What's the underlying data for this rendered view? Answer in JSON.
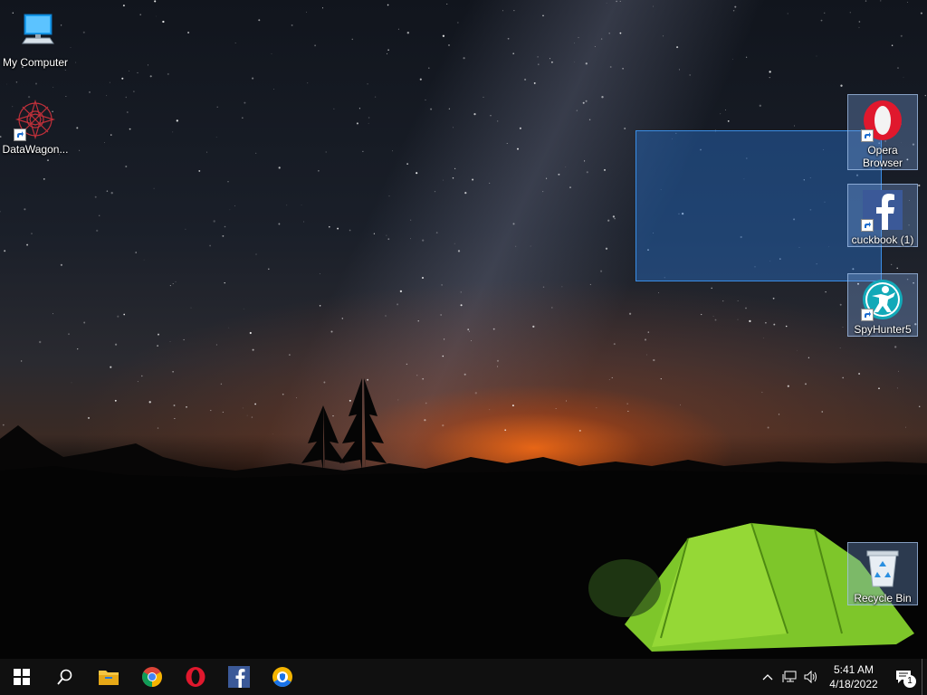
{
  "desktop": {
    "icons_left": [
      {
        "label": "My Computer",
        "icon": "computer-icon"
      },
      {
        "label": "DataWagon...",
        "icon": "datawagon-icon"
      }
    ],
    "icons_right": [
      {
        "label": "Opera Browser",
        "icon": "opera-icon"
      },
      {
        "label": "cuckbook (1)",
        "icon": "facebook-icon"
      },
      {
        "label": "SpyHunter5",
        "icon": "spyhunter-icon"
      },
      {
        "label": "Recycle Bin",
        "icon": "recycle-bin-icon"
      }
    ]
  },
  "taskbar": {
    "apps": [
      "start-icon",
      "search-icon",
      "file-explorer-icon",
      "chrome-icon",
      "opera-icon",
      "facebook-icon",
      "shield-browser-icon"
    ],
    "tray": {
      "time": "5:41 AM",
      "date": "4/18/2022",
      "notification_count": "1"
    }
  },
  "colors": {
    "selection": "#3a8ee6",
    "taskbar": "#101010",
    "opera_red": "#e0182d",
    "facebook_blue": "#3b5998"
  }
}
